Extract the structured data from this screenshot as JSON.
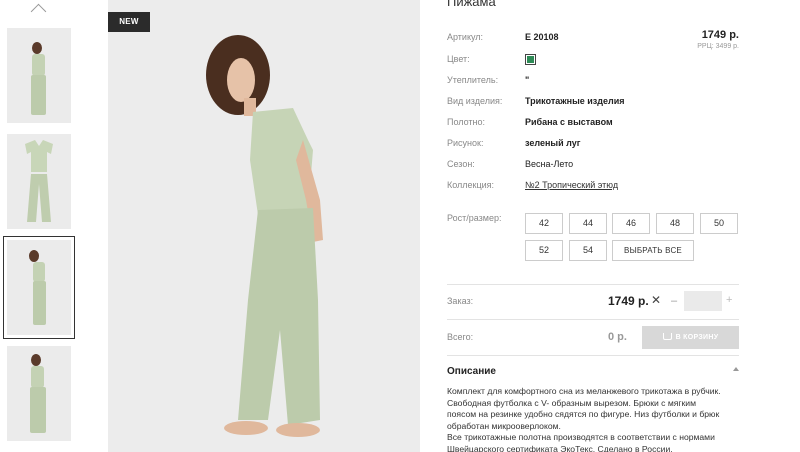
{
  "product": {
    "title": "Пижама",
    "new_badge": "NEW",
    "price": "1749 р.",
    "rrp": "РРЦ: 3499 р.",
    "color_hex": "#2e8b57"
  },
  "properties": [
    {
      "label": "Артикул:",
      "value": "E 20108"
    },
    {
      "label": "Цвет:",
      "value": ""
    },
    {
      "label": "Утеплитель:",
      "value": "\""
    },
    {
      "label": "Вид изделия:",
      "value": "Трикотажные изделия"
    },
    {
      "label": "Полотно:",
      "value": "Рибана с выставом"
    },
    {
      "label": "Рисунок:",
      "value": "зеленый луг"
    },
    {
      "label": "Сезон:",
      "value": "Весна-Лето"
    },
    {
      "label": "Коллекция:",
      "value": "№2 Тропический этюд"
    }
  ],
  "sizes": {
    "label": "Рост/размер:",
    "row1": [
      "42",
      "44",
      "46",
      "48",
      "50"
    ],
    "row2": [
      "52",
      "54"
    ],
    "select_all": "ВЫБРАТЬ ВСЕ"
  },
  "order": {
    "label": "Заказ:",
    "price": "1749 р.",
    "times": "✕",
    "minus": "–",
    "plus": "+",
    "quantity": ""
  },
  "total": {
    "label": "Всего:",
    "value": "0 р.",
    "cart_button": "В КОРЗИНУ"
  },
  "description": {
    "title": "Описание",
    "lines": [
      "Комплект для комфортного сна из меланжевого трикотажа в рубчик.",
      "Свободная футболка с V- образным вырезом. Брюки с мягким",
      "поясом на резинке удобно сядятся по фигуре. Низ футболки и брюк",
      "обработан микрооверлоком.",
      "Все трикотажные полотна производятся в соответствии с нормами",
      "Швейцарского сертификата ЭкоТекс. Сделано в России."
    ]
  }
}
